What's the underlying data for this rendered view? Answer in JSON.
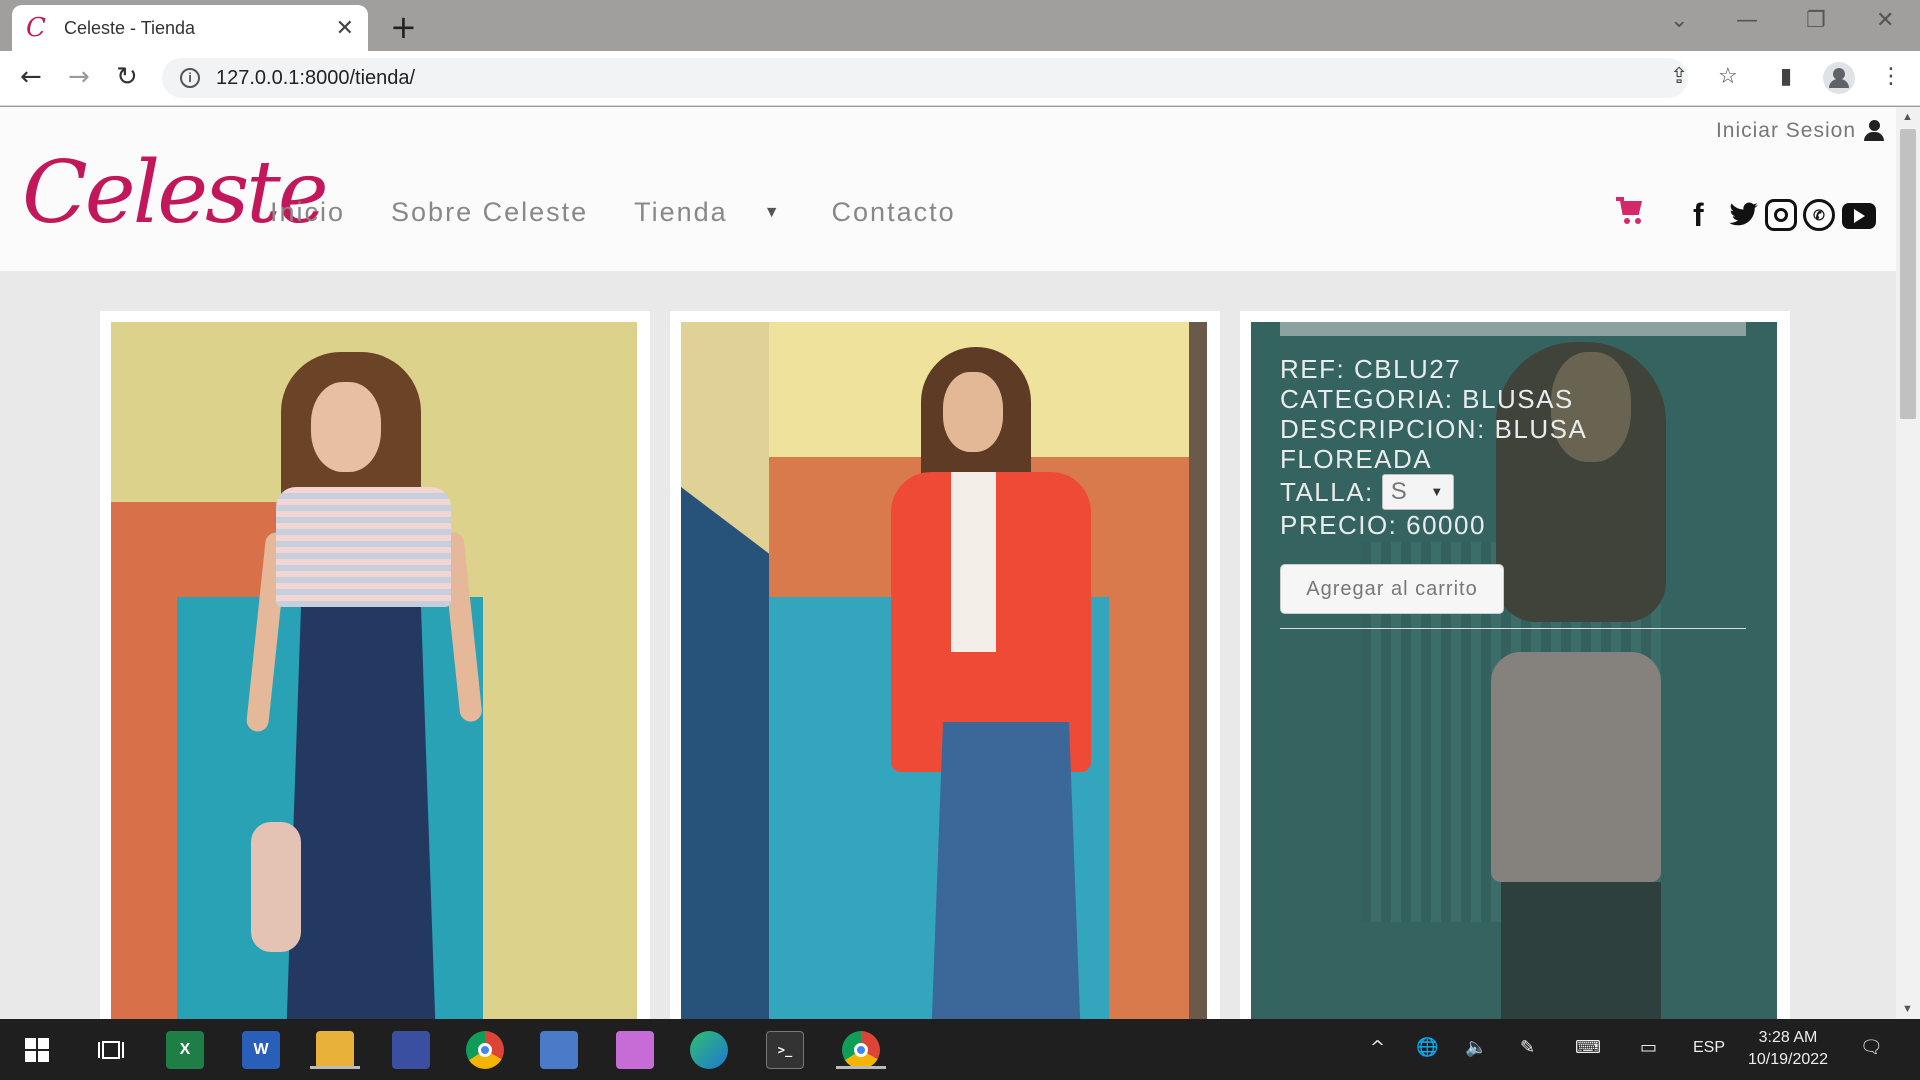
{
  "browser": {
    "tab_title": "Celeste - Tienda",
    "tab_favicon_letter": "C",
    "tab_close_symbol": "✕",
    "new_tab_symbol": "+",
    "url": "127.0.0.1:8000/tienda/",
    "back_icon": "←",
    "forward_icon": "→",
    "reload_icon": "↻",
    "share_icon": "⇪",
    "star_icon": "☆",
    "sidepanel_icon": "▮",
    "menu_icon": "⋮",
    "win_chevron": "⌄",
    "win_minimize": "—",
    "win_restore": "❐",
    "win_close": "✕"
  },
  "site": {
    "logo": "Celeste",
    "login_label": "Iniciar Sesion",
    "nav": {
      "inicio": "Inicio",
      "sobre": "Sobre Celeste",
      "tienda": "Tienda",
      "contacto": "Contacto"
    },
    "nav_caret": "▼",
    "social": {
      "facebook": "f",
      "twitter": "🐦",
      "whatsapp": "✆"
    },
    "accent_color": "#c2185b"
  },
  "product": {
    "ref": "REF: CBLU27",
    "categoria": "CATEGORIA: BLUSAS",
    "descripcion": "DESCRIPCION: BLUSA FLOREADA",
    "talla_label": "TALLA:",
    "talla_value": "S",
    "precio": "PRECIO: 60000",
    "add_button": "Agregar al carrito"
  },
  "taskbar": {
    "excel_letter": "X",
    "word_letter": "W",
    "terminal_text": ">_",
    "tray_chevron": "^",
    "tray_globe": "🌐",
    "tray_volume": "🔈",
    "tray_pen": "✎",
    "tray_keyboard": "⌨",
    "tray_display": "▭",
    "language": "ESP",
    "time": "3:28 AM",
    "date": "10/19/2022",
    "notification_icon": "🗨"
  }
}
